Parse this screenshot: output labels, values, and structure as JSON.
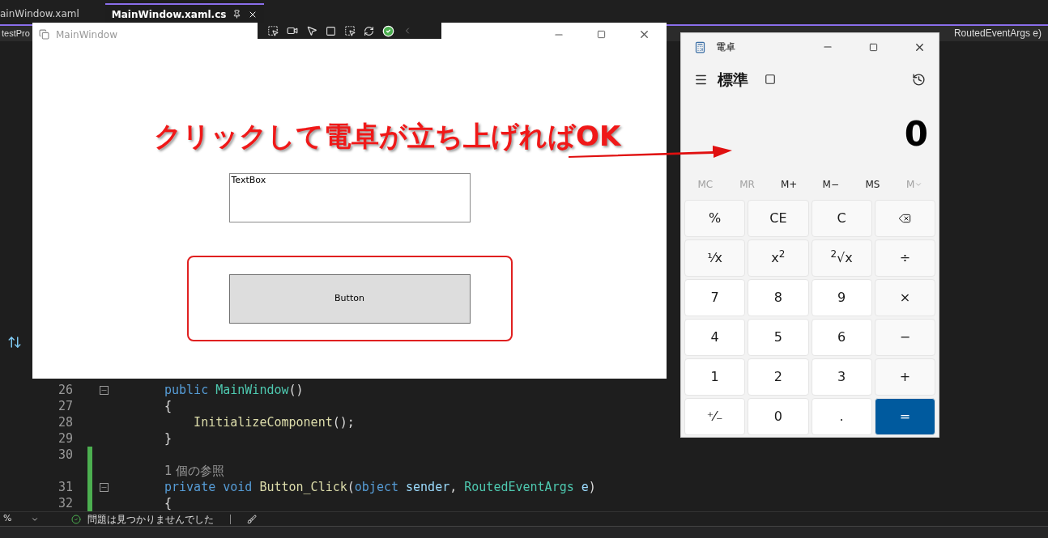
{
  "ide": {
    "tabs": [
      {
        "label": "ainWindow.xaml",
        "selected": false
      },
      {
        "label": "MainWindow.xaml.cs",
        "selected": true
      }
    ],
    "project": "testPro",
    "breadcrumb": "RoutedEventArgs e)",
    "code_lines": [
      {
        "number": "26",
        "foldable": true,
        "changed": false,
        "tokens": [
          {
            "text": "public ",
            "kind": "keyword"
          },
          {
            "text": "MainWindow",
            "kind": "type"
          },
          {
            "text": "()",
            "kind": "plain"
          }
        ]
      },
      {
        "number": "27",
        "foldable": false,
        "changed": false,
        "tokens": [
          {
            "text": "{",
            "kind": "plain"
          }
        ]
      },
      {
        "number": "28",
        "foldable": false,
        "changed": false,
        "tokens": [
          {
            "text": "    InitializeComponent",
            "kind": "method"
          },
          {
            "text": "();",
            "kind": "plain"
          }
        ]
      },
      {
        "number": "29",
        "foldable": false,
        "changed": false,
        "tokens": [
          {
            "text": "}",
            "kind": "plain"
          }
        ]
      },
      {
        "number": "30",
        "foldable": false,
        "changed": true
      },
      {
        "foldable": false,
        "changed": true,
        "tokens": [
          {
            "text": "1 個の参照",
            "kind": "lens"
          }
        ]
      },
      {
        "number": "31",
        "foldable": true,
        "changed": true,
        "tokens": [
          {
            "text": "private void ",
            "kind": "keyword"
          },
          {
            "text": "Button_Click",
            "kind": "method"
          },
          {
            "text": "(",
            "kind": "plain"
          },
          {
            "text": "object ",
            "kind": "keyword"
          },
          {
            "text": "sender",
            "kind": "param"
          },
          {
            "text": ", ",
            "kind": "plain"
          },
          {
            "text": "RoutedEventArgs ",
            "kind": "type"
          },
          {
            "text": "e",
            "kind": "param"
          },
          {
            "text": ")",
            "kind": "plain"
          }
        ]
      },
      {
        "number": "32",
        "foldable": false,
        "changed": true,
        "tokens": [
          {
            "text": "{",
            "kind": "plain"
          }
        ]
      }
    ],
    "status_bar": {
      "zoom": "%",
      "message": "問題は見つかりませんでした"
    }
  },
  "wpf_window": {
    "title": "MainWindow",
    "textbox": "TextBox",
    "button": "Button"
  },
  "annotation": "クリックして電卓が立ち上げればOK",
  "calculator": {
    "title": "電卓",
    "mode": "標準",
    "display": "0",
    "memory": [
      {
        "label": "MC",
        "disabled": true,
        "kind": "plain"
      },
      {
        "label": "MR",
        "disabled": true,
        "kind": "plain"
      },
      {
        "label": "M+",
        "disabled": false,
        "kind": "plain"
      },
      {
        "label": "M−",
        "disabled": false,
        "kind": "plain"
      },
      {
        "label": "MS",
        "disabled": false,
        "kind": "plain"
      },
      {
        "label": "M",
        "disabled": true,
        "kind": "menu"
      }
    ],
    "keys": [
      {
        "label": "%",
        "kind": "function"
      },
      {
        "label": "CE",
        "kind": "function"
      },
      {
        "label": "C",
        "kind": "function"
      },
      {
        "kind": "backspace"
      },
      {
        "label": "¹⁄x",
        "kind": "function"
      },
      {
        "label": "x$^{2}$",
        "kind": "function"
      },
      {
        "label": "$^{2}$√x",
        "kind": "function"
      },
      {
        "label": "÷",
        "kind": "function"
      },
      {
        "label": "7",
        "kind": "number"
      },
      {
        "label": "8",
        "kind": "number"
      },
      {
        "label": "9",
        "kind": "number"
      },
      {
        "label": "×",
        "kind": "function"
      },
      {
        "label": "4",
        "kind": "number"
      },
      {
        "label": "5",
        "kind": "number"
      },
      {
        "label": "6",
        "kind": "number"
      },
      {
        "label": "−",
        "kind": "function"
      },
      {
        "label": "1",
        "kind": "number"
      },
      {
        "label": "2",
        "kind": "number"
      },
      {
        "label": "3",
        "kind": "number"
      },
      {
        "label": "+",
        "kind": "function"
      },
      {
        "label": "⁺⁄₋",
        "kind": "number"
      },
      {
        "label": "0",
        "kind": "number"
      },
      {
        "label": ".",
        "kind": "number"
      },
      {
        "label": "=",
        "kind": "equals"
      }
    ]
  }
}
